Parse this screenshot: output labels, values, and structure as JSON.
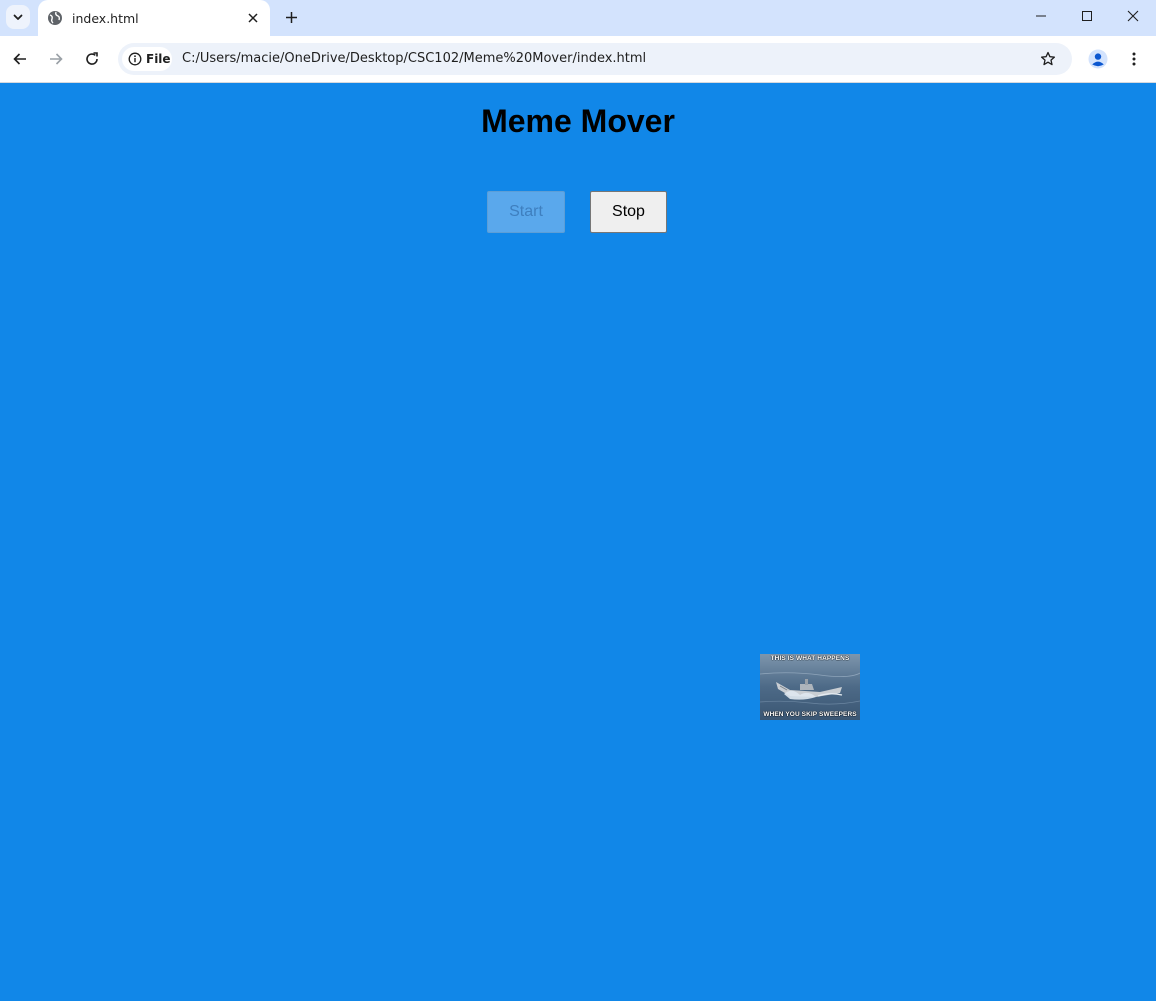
{
  "browser": {
    "tab": {
      "title": "index.html",
      "favicon": "globe-icon"
    },
    "site_chip": "File",
    "url": "C:/Users/macie/OneDrive/Desktop/CSC102/Meme%20Mover/index.html"
  },
  "page": {
    "title": "Meme Mover",
    "start_label": "Start",
    "stop_label": "Stop",
    "start_disabled": true,
    "meme": {
      "top_caption": "THIS IS WHAT HAPPENS",
      "bottom_caption": "WHEN YOU SKIP SWEEPERS"
    }
  },
  "colors": {
    "page_background": "#1187e8",
    "tabstrip": "#d3e3fd",
    "omnibox": "#edf2fa"
  }
}
